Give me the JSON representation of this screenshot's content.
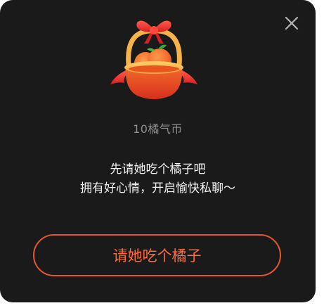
{
  "dialog": {
    "close_icon": "close-icon",
    "illustration_icon": "orange-gift-basket-icon",
    "amount_text": "10橘气币",
    "message_line1": "先请她吃个橘子吧",
    "message_line2": "拥有好心情，开启愉快私聊～",
    "cta_label": "请她吃个橘子",
    "accent_color": "#ff6a3a"
  }
}
